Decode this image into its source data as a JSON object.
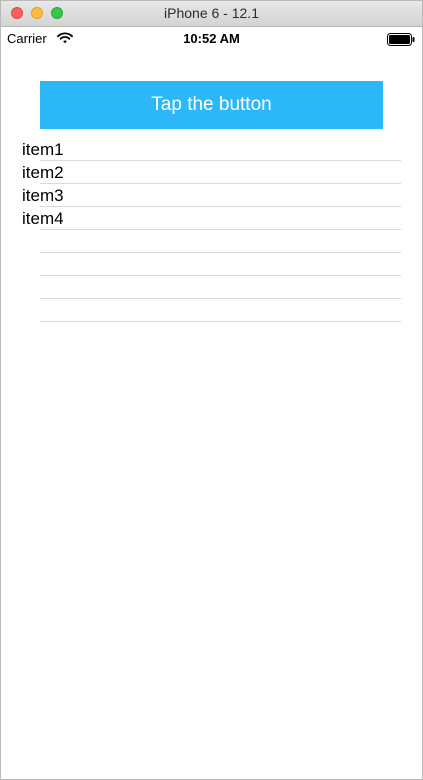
{
  "window": {
    "title": "iPhone 6 - 12.1"
  },
  "status_bar": {
    "carrier": "Carrier",
    "time": "10:52 AM",
    "icons": [
      "wifi-icon",
      "battery-icon"
    ]
  },
  "main": {
    "button_label": "Tap the button",
    "items": [
      "item1",
      "item2",
      "item3",
      "item4",
      "",
      "",
      "",
      ""
    ]
  },
  "colors": {
    "button_bg": "#2cb8f8",
    "button_text": "#ffffff",
    "separator": "#d9d9d9"
  }
}
